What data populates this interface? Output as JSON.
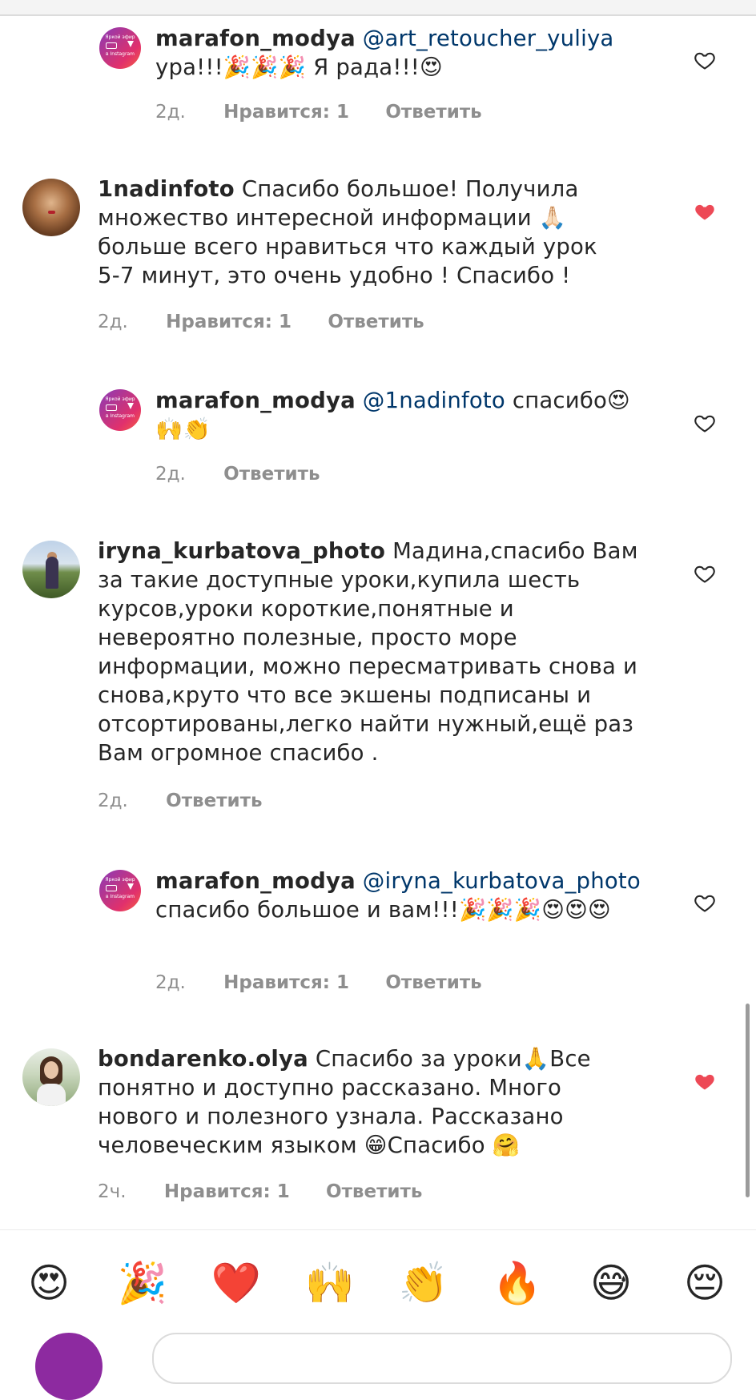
{
  "comments": [
    {
      "username": "marafon_modya",
      "avatar_lines": [
        "Яркой эфир",
        "в Instagram"
      ],
      "mention": "@art_retoucher_yuliya",
      "text": "ура!!!🎉🎉🎉 Я рада!!!😍",
      "time": "2д.",
      "likes": "Нравится: 1",
      "reply": "Ответить",
      "liked": false
    },
    {
      "username": "1nadinfoto",
      "mention": "",
      "text": "Спасибо большое! Получила множество интересной информации 🙏🏻 больше всего нравиться что каждый урок 5-7 минут, это очень удобно ! Спасибо !",
      "time": "2д.",
      "likes": "Нравится: 1",
      "reply": "Ответить",
      "liked": true
    },
    {
      "username": "marafon_modya",
      "avatar_lines": [
        "Яркой эфир",
        "в Instagram"
      ],
      "mention": "@1nadinfoto",
      "text": "спасибо😍🙌👏",
      "time": "2д.",
      "likes": "",
      "reply": "Ответить",
      "liked": false
    },
    {
      "username": "iryna_kurbatova_photo",
      "mention": "",
      "text": "Мадина,спасибо Вам за такие доступные уроки,купила шесть курсов,уроки короткие,понятные и невероятно полезные, просто  море информации, можно пересматривать снова и снова,круто что все экшены подписаны и отсортированы,легко найти нужный,ещё раз Вам огромное спасибо .",
      "time": "2д.",
      "likes": "",
      "reply": "Ответить",
      "liked": false
    },
    {
      "username": "marafon_modya",
      "avatar_lines": [
        "Яркой эфир",
        "в Instagram"
      ],
      "mention": "@iryna_kurbatova_photo",
      "text": "спасибо большое и вам!!!🎉🎉🎉😍😍😍",
      "time": "2д.",
      "likes": "Нравится: 1",
      "reply": "Ответить",
      "liked": false
    },
    {
      "username": "bondarenko.olya",
      "mention": "",
      "text": "Спасибо за уроки🙏Все понятно и доступно рассказано. Много нового и полезного узнала. Рассказано человеческим языком 😁Спасибо 🤗",
      "time": "2ч.",
      "likes": "Нравится: 1",
      "reply": "Ответить",
      "liked": true
    }
  ],
  "emoji_bar": [
    "😍",
    "🎉",
    "❤️",
    "🙌",
    "👏",
    "🔥",
    "😅",
    "😔"
  ],
  "colors": {
    "liked_heart": "#ed4956",
    "mention": "#00376b",
    "meta": "#8e8e8e",
    "text": "#262626",
    "brand_avatar": "#c13584"
  }
}
